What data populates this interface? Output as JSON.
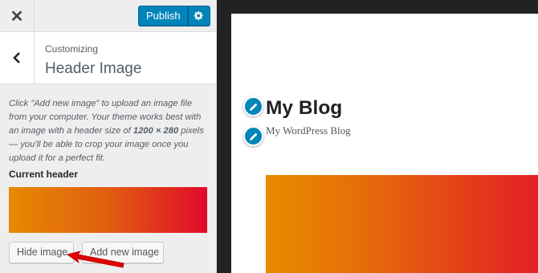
{
  "topbar": {
    "close_icon": "close-icon",
    "publish_label": "Publish",
    "settings_icon": "gear-icon"
  },
  "section": {
    "breadcrumb": "Customizing",
    "title": "Header Image",
    "back_icon": "chevron-left-icon"
  },
  "panel": {
    "description_1": "Click \"Add new image\" to upload an image file from your computer. Your theme works best with an image with a header size of ",
    "description_size": "1200 × 280",
    "description_2": " pixels — you'll be able to crop your image once you upload it for a perfect fit.",
    "current_header_label": "Current header",
    "hide_image_label": "Hide image",
    "add_new_image_label": "Add new image"
  },
  "preview": {
    "site_title": "My Blog",
    "site_description": "My WordPress Blog"
  },
  "colors": {
    "accent": "#0085ba",
    "annotation_arrow": "#e00000",
    "gradient_start": "#e78a00",
    "gradient_end": "#e20a2a"
  }
}
